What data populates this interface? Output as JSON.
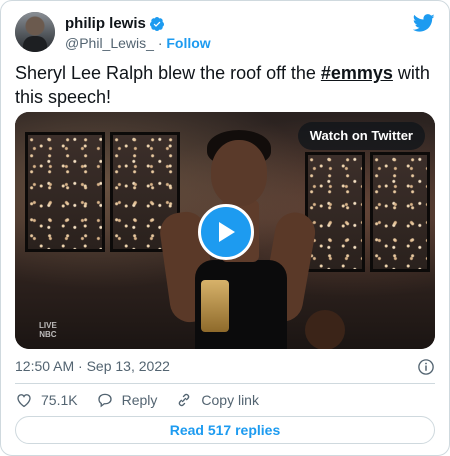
{
  "author": {
    "name": "philip lewis",
    "handle": "@Phil_Lewis_",
    "separator": "·",
    "follow_label": "Follow"
  },
  "tweet": {
    "text_before": "Sheryl Lee Ralph blew the roof off the ",
    "hashtag": "#emmys",
    "text_after": " with this speech!"
  },
  "media": {
    "watch_label": "Watch on Twitter",
    "network_top": "LIVE",
    "network_bottom": "NBC"
  },
  "meta": {
    "timestamp": "12:50 AM · Sep 13, 2022"
  },
  "actions": {
    "likes": "75.1K",
    "reply_label": "Reply",
    "copy_link_label": "Copy link"
  },
  "footer": {
    "read_replies_label": "Read 517 replies"
  },
  "colors": {
    "accent": "#1d9bf0",
    "text": "#0f1419",
    "muted": "#536471",
    "border": "#cfd9de"
  },
  "icons": [
    "verified-badge-icon",
    "twitter-bird-icon",
    "play-icon",
    "info-icon",
    "heart-icon",
    "reply-icon",
    "link-icon"
  ]
}
